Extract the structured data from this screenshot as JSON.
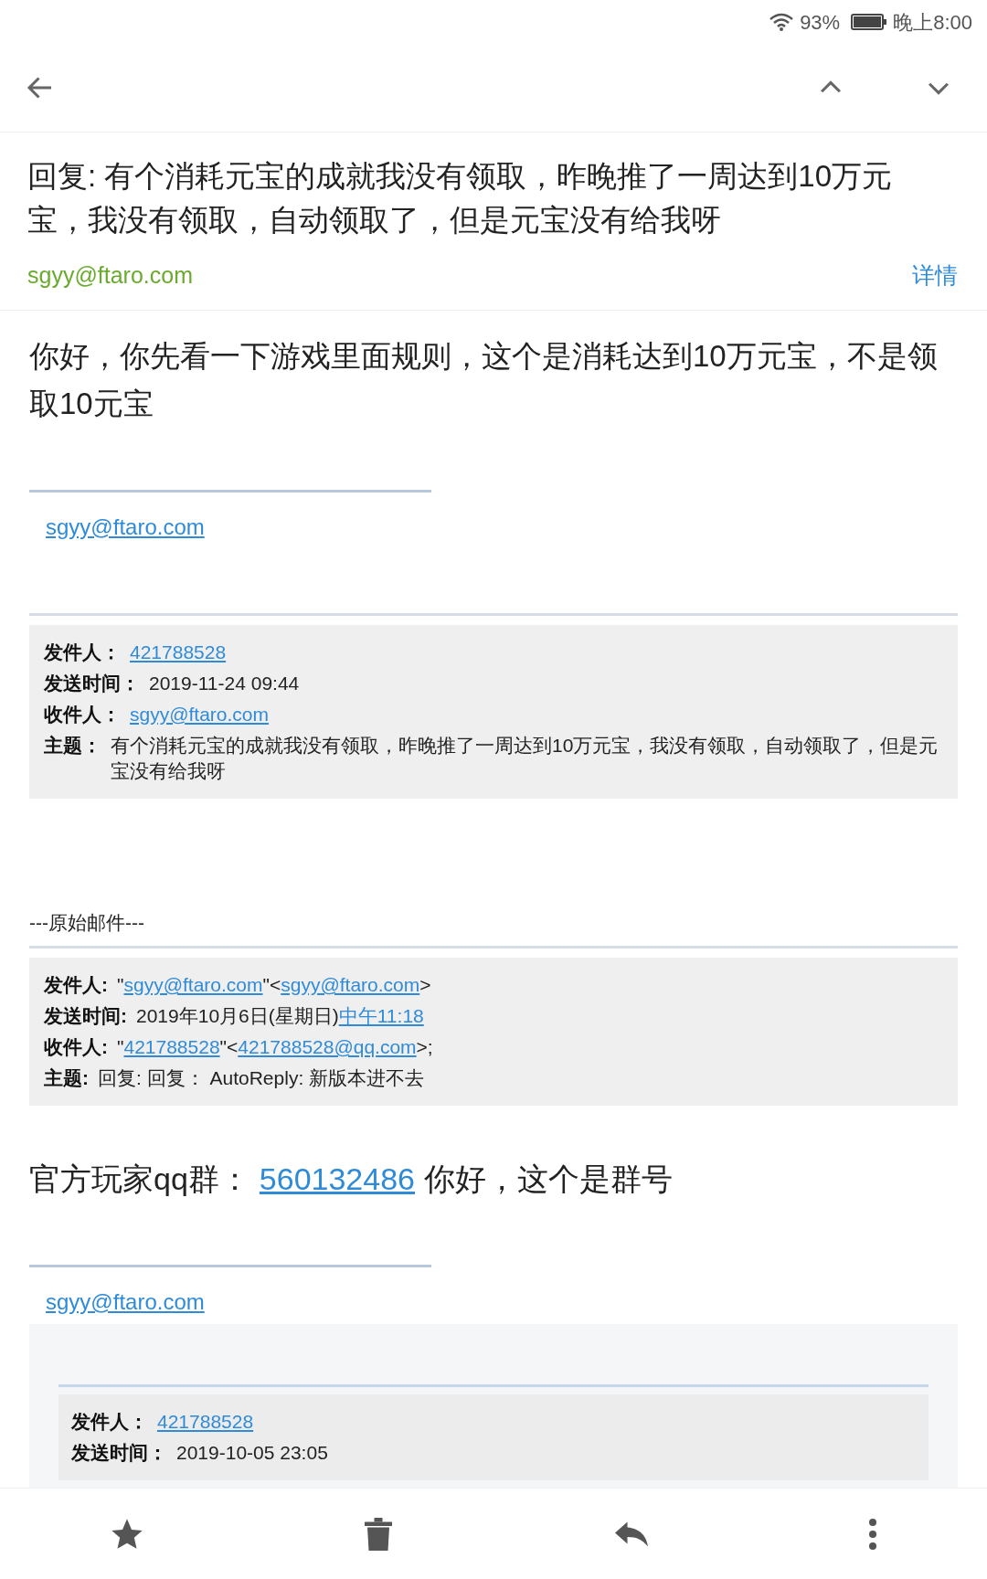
{
  "status_bar": {
    "battery": "93%",
    "time": "晚上8:00"
  },
  "subject": "回复: 有个消耗元宝的成就我没有领取，昨晚推了一周达到10万元宝，我没有领取，自动领取了，但是元宝没有给我呀",
  "sender": "sgyy@ftaro.com",
  "details_link": "详情",
  "blocks": [
    {
      "kind": "paragraph",
      "text": "你好，你先看一下游戏里面规则，这个是消耗达到10万元宝，不是领取10元宝"
    },
    {
      "kind": "signature",
      "text": "sgyy@ftaro.com"
    },
    {
      "kind": "quote",
      "fields": [
        {
          "label": "发件人：",
          "parts": [
            {
              "text": "421788528",
              "link": true
            }
          ]
        },
        {
          "label": "发送时间：",
          "parts": [
            {
              "text": "2019-11-24 09:44",
              "link": false
            }
          ]
        },
        {
          "label": "收件人：",
          "parts": [
            {
              "text": "sgyy@ftaro.com",
              "link": true
            }
          ]
        },
        {
          "label": "主题：",
          "parts": [
            {
              "text": "有个消耗元宝的成就我没有领取，昨晚推了一周达到10万元宝，我没有领取，自动领取了，但是元宝没有给我呀",
              "link": false
            }
          ]
        }
      ]
    },
    {
      "kind": "separator",
      "text": "---原始邮件---"
    },
    {
      "kind": "quote",
      "fields": [
        {
          "label": "发件人:",
          "parts": [
            {
              "text": "\"",
              "link": false
            },
            {
              "text": "sgyy@ftaro.com",
              "link": true
            },
            {
              "text": "\"<",
              "link": false
            },
            {
              "text": "sgyy@ftaro.com",
              "link": true
            },
            {
              "text": ">",
              "link": false
            }
          ]
        },
        {
          "label": "发送时间:",
          "parts": [
            {
              "text": "2019年10月6日(星期日)",
              "link": false
            },
            {
              "text": "中午11:18",
              "link": true
            }
          ]
        },
        {
          "label": "收件人:",
          "parts": [
            {
              "text": "\"",
              "link": false
            },
            {
              "text": "421788528",
              "link": true
            },
            {
              "text": "\"<",
              "link": false
            },
            {
              "text": "421788528@qq.com",
              "link": true
            },
            {
              "text": ">;",
              "link": false
            }
          ]
        },
        {
          "label": "主题:",
          "parts": [
            {
              "text": "回复: 回复： AutoReply: 新版本进不去",
              "link": false
            }
          ]
        }
      ]
    },
    {
      "kind": "group_line",
      "parts": [
        {
          "text": "官方玩家qq群：",
          "link": false
        },
        {
          "text": "560132486",
          "link": true
        },
        {
          "text": "你好，这个是群号",
          "link": false
        }
      ]
    },
    {
      "kind": "signature",
      "text": "sgyy@ftaro.com"
    },
    {
      "kind": "nested_quote",
      "fields": [
        {
          "label": "发件人：",
          "parts": [
            {
              "text": "421788528",
              "link": true
            }
          ]
        },
        {
          "label": "发送时间：",
          "parts": [
            {
              "text": "2019-10-05 23:05",
              "link": false
            }
          ]
        }
      ]
    }
  ]
}
